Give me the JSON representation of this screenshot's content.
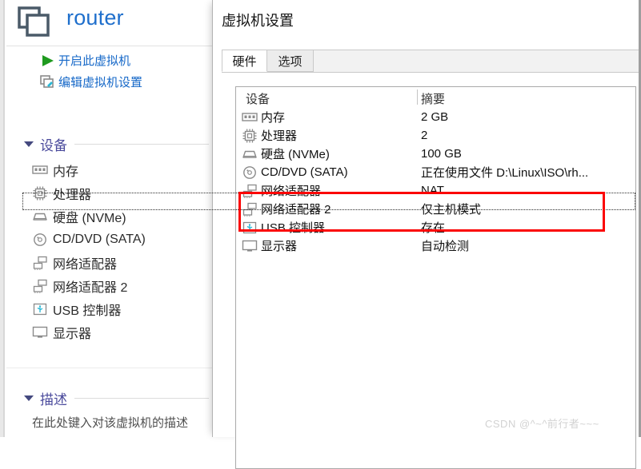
{
  "left_panel": {
    "vm_icon": "two-squares-icon",
    "vm_title": "router",
    "actions": [
      {
        "icon": "play-triangle-icon",
        "label": "开启此虚拟机"
      },
      {
        "icon": "edit-settings-icon",
        "label": "编辑虚拟机设置"
      }
    ],
    "sections": {
      "devices_label": "设备",
      "description_label": "描述",
      "description_text": "在此处键入对该虚拟机的描述"
    },
    "devices": [
      {
        "icon": "memory-icon",
        "label": "内存"
      },
      {
        "icon": "cpu-icon",
        "label": "处理器"
      },
      {
        "icon": "harddisk-icon",
        "label": "硬盘 (NVMe)"
      },
      {
        "icon": "cd-icon",
        "label": "CD/DVD (SATA)"
      },
      {
        "icon": "network-icon",
        "label": "网络适配器"
      },
      {
        "icon": "network-icon",
        "label": "网络适配器 2"
      },
      {
        "icon": "usb-icon",
        "label": "USB 控制器"
      },
      {
        "icon": "display-icon",
        "label": "显示器"
      }
    ]
  },
  "dialog": {
    "title": "虚拟机设置",
    "tabs": [
      {
        "label": "硬件",
        "selected": true
      },
      {
        "label": "选项",
        "selected": false
      }
    ],
    "table": {
      "columns": [
        "设备",
        "摘要"
      ],
      "rows": [
        {
          "icon": "memory-icon",
          "device": "内存",
          "summary": "2 GB",
          "focused": false,
          "highlighted": false
        },
        {
          "icon": "cpu-icon",
          "device": "处理器",
          "summary": "2",
          "focused": false,
          "highlighted": false
        },
        {
          "icon": "harddisk-icon",
          "device": "硬盘 (NVMe)",
          "summary": "100 GB",
          "focused": false,
          "highlighted": false
        },
        {
          "icon": "cd-icon",
          "device": "CD/DVD (SATA)",
          "summary": "正在使用文件 D:\\Linux\\ISO\\rh...",
          "focused": false,
          "highlighted": false
        },
        {
          "icon": "network-icon",
          "device": "网络适配器",
          "summary": "NAT",
          "focused": true,
          "highlighted": true
        },
        {
          "icon": "network-icon",
          "device": "网络适配器 2",
          "summary": "仅主机模式",
          "focused": false,
          "highlighted": true
        },
        {
          "icon": "usb-icon",
          "device": "USB 控制器",
          "summary": "存在",
          "focused": false,
          "highlighted": false
        },
        {
          "icon": "display-icon",
          "device": "显示器",
          "summary": "自动检测",
          "focused": false,
          "highlighted": false
        }
      ]
    },
    "annotation": {
      "shape": "red-rectangle",
      "color": "#fb0505"
    }
  },
  "watermark": {
    "text": "CSDN @^~^前行者~~~"
  },
  "colors": {
    "link_blue": "#1668c8",
    "title_blue": "#1f6fcc",
    "section_purple": "#4a4a9c",
    "annotation_red": "#fb0505",
    "icon_gray": "#8a8a8a",
    "play_green": "#1f9a1f"
  }
}
